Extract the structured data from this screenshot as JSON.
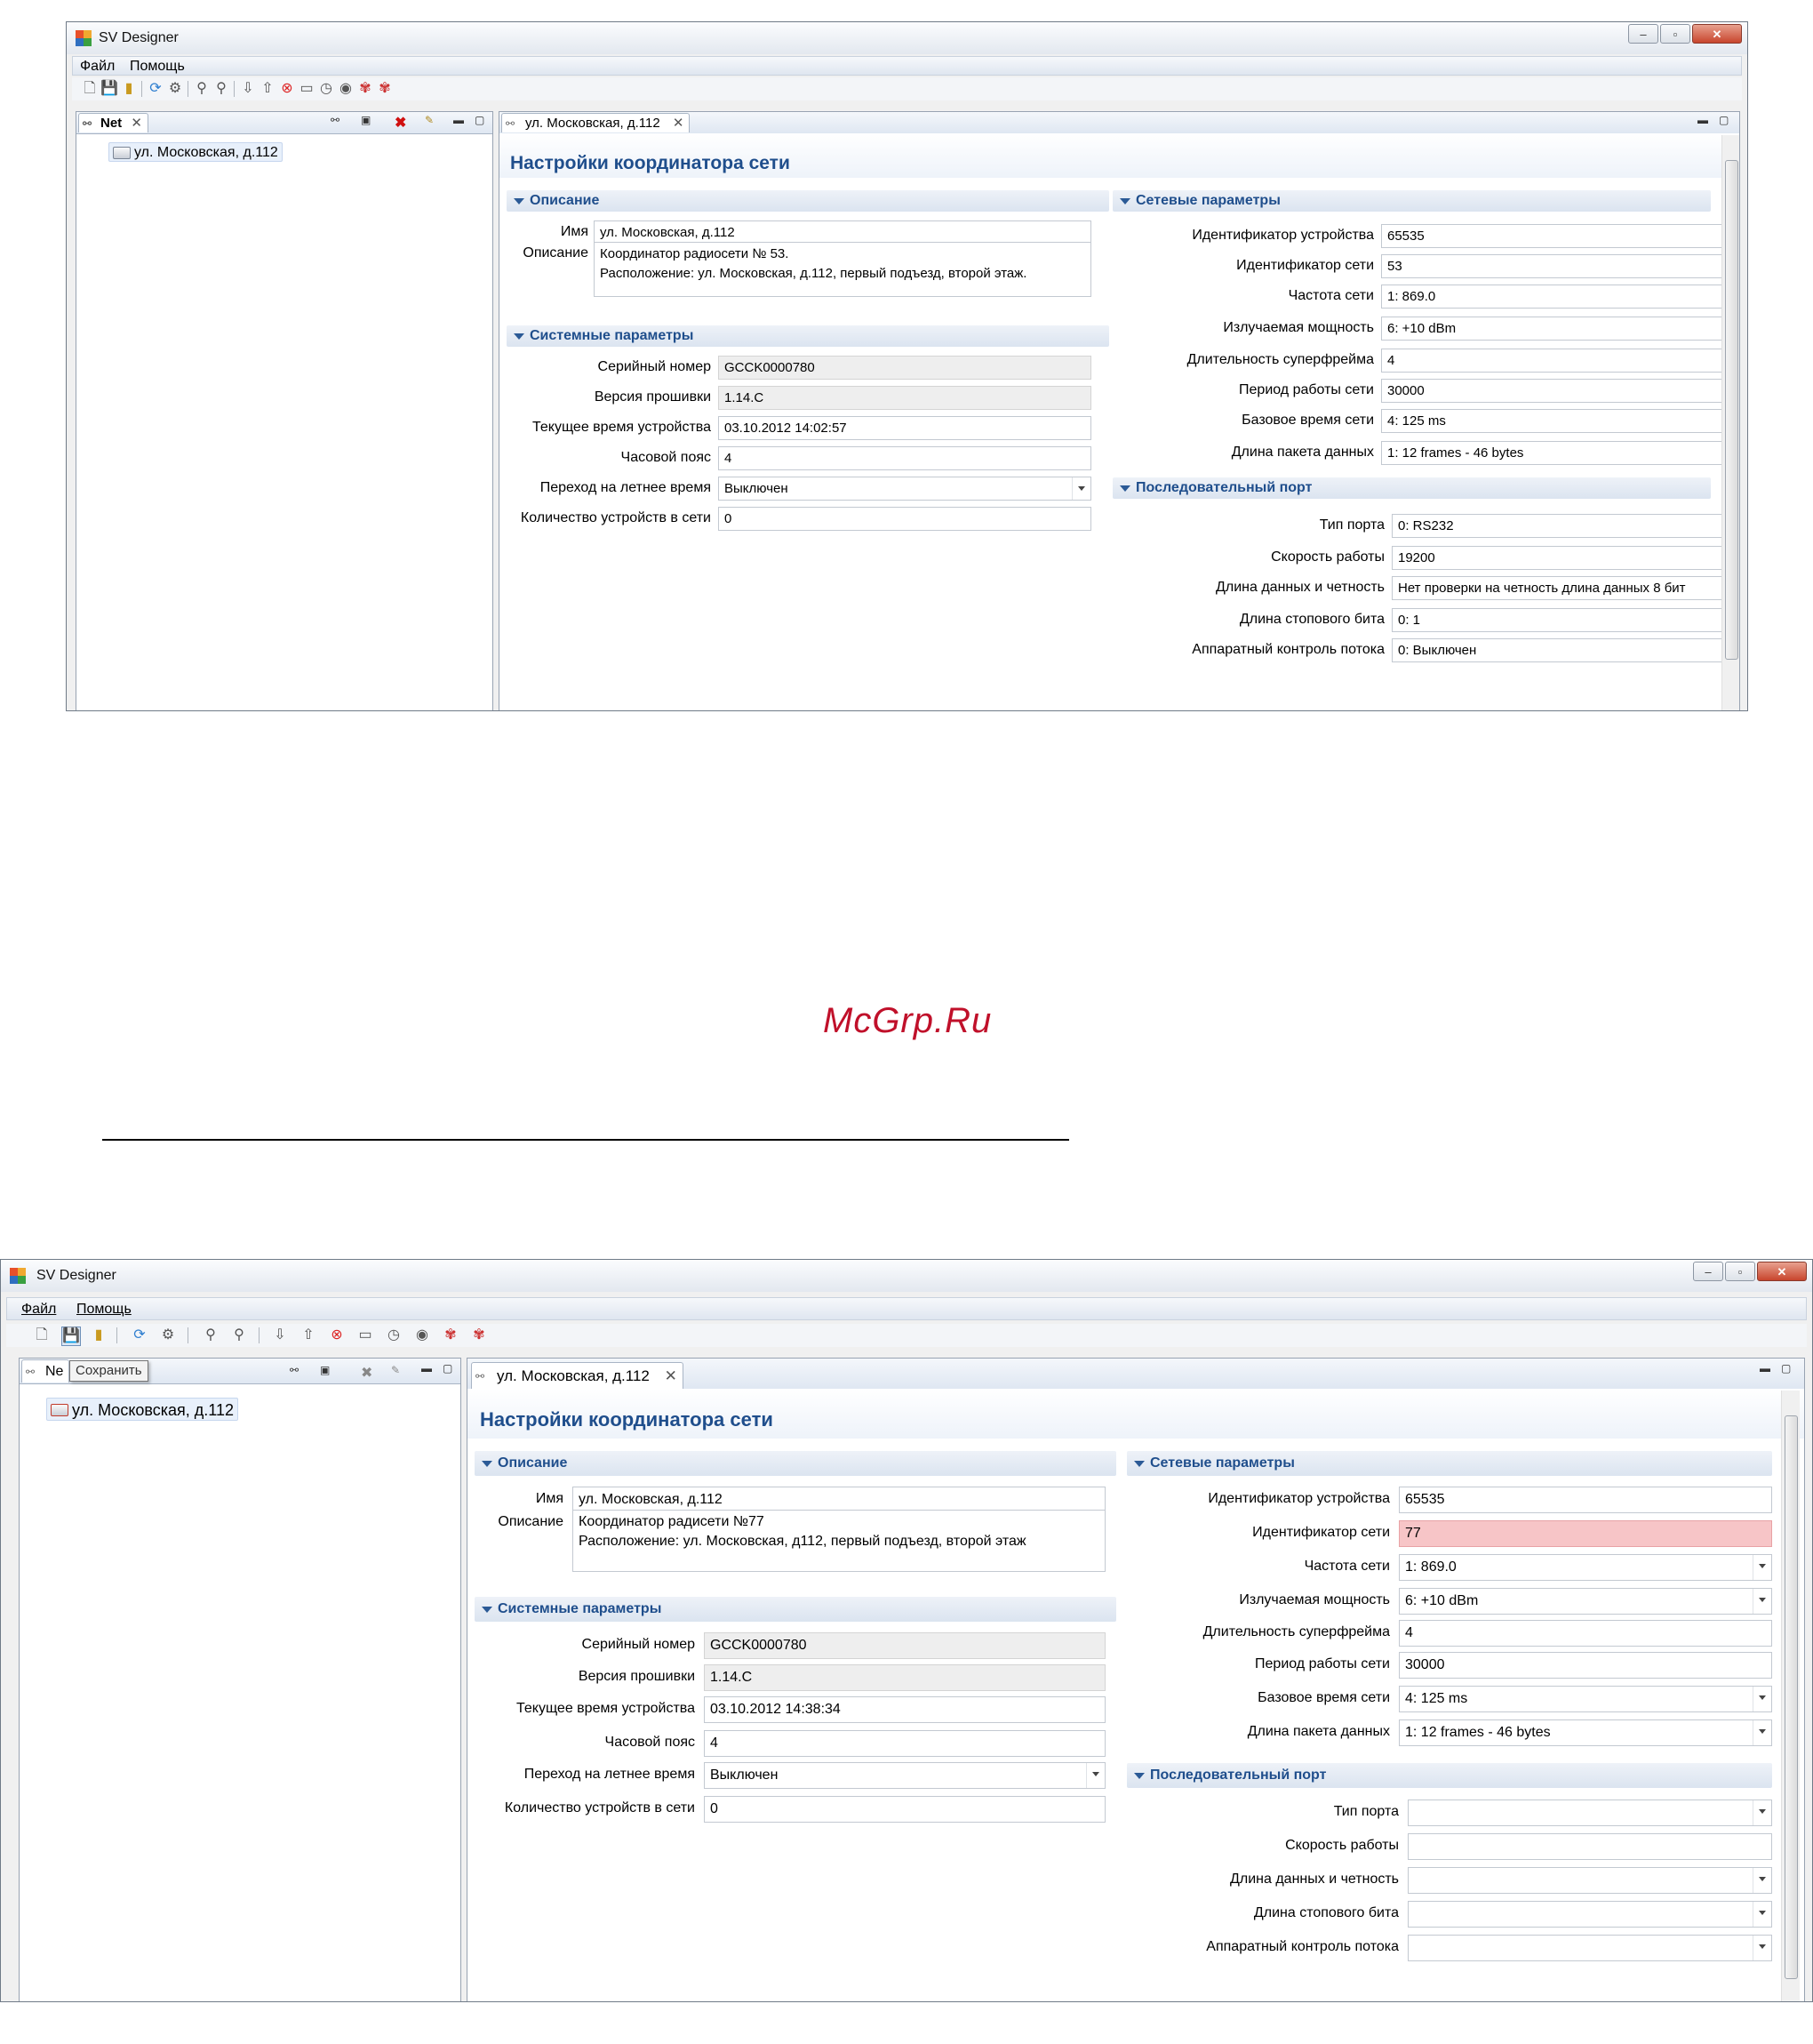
{
  "app_title": "SV Designer",
  "menu": [
    "Файл",
    "Помощь"
  ],
  "window_buttons": {
    "minimize": "–",
    "maximize": "▫",
    "close": "✕"
  },
  "toolbar_icons": [
    "new-file-icon",
    "save-icon",
    "open-icon",
    "refresh-icon",
    "settings-icon",
    "read-icon",
    "write-icon",
    "download-icon",
    "upload-icon",
    "stop-icon",
    "clock-icon",
    "time-icon",
    "eye-icon",
    "radio-icon",
    "radio-alt-icon"
  ],
  "watermark": "McGrp.Ru",
  "colors": {
    "section_text": "#1f4e8c",
    "error_field": "#f7c5c7",
    "close_button": "#c8452d"
  },
  "win1": {
    "tree_view_tab": "Net",
    "tree_item": "ул. Московская, д.112",
    "editor_tab": "ул. Московская, д.112",
    "form_title": "Настройки координатора сети",
    "sec_desc": "Описание",
    "desc_rows": [
      {
        "label": "Имя",
        "value": "ул. Московская, д.112"
      },
      {
        "label": "Описание",
        "value": "Координатор радиосети № 53.\nРасположение: ул. Московская, д.112, первый подъезд, второй этаж."
      }
    ],
    "sec_sys": "Системные параметры",
    "sys_rows": [
      {
        "label": "Серийный номер",
        "value": "GCCK0000780"
      },
      {
        "label": "Версия прошивки",
        "value": "1.14.C"
      },
      {
        "label": "Текущее время устройства",
        "value": "03.10.2012 14:02:57"
      },
      {
        "label": "Часовой пояс",
        "value": "4"
      },
      {
        "label": "Переход на летнее время",
        "value": "Выключен"
      },
      {
        "label": "Количество устройств в сети",
        "value": "0"
      }
    ],
    "sec_net": "Сетевые параметры",
    "net_rows": [
      {
        "label": "Идентификатор устройства",
        "value": "65535"
      },
      {
        "label": "Идентификатор сети",
        "value": "53"
      },
      {
        "label": "Частота сети",
        "value": "1: 869.0"
      },
      {
        "label": "Излучаемая мощность",
        "value": "6: +10 dBm"
      },
      {
        "label": "Длительность суперфрейма",
        "value": "4"
      },
      {
        "label": "Период работы сети",
        "value": "30000"
      },
      {
        "label": "Базовое время сети",
        "value": "4: 125 ms"
      },
      {
        "label": "Длина пакета данных",
        "value": "1: 12 frames - 46 bytes"
      }
    ],
    "sec_ser": "Последовательный порт",
    "ser_rows": [
      {
        "label": "Тип порта",
        "value": "0: RS232"
      },
      {
        "label": "Скорость работы",
        "value": "19200"
      },
      {
        "label": "Длина данных и четность",
        "value": "Нет проверки на четность длина данных 8 бит"
      },
      {
        "label": "Длина стопового бита",
        "value": "0: 1"
      },
      {
        "label": "Аппаратный контроль потока",
        "value": "0: Выключен"
      }
    ]
  },
  "win2": {
    "tree_view_tab": "Ne",
    "tooltip": "Сохранить",
    "tree_item": "ул. Московская, д.112",
    "editor_tab": "ул. Московская, д.112",
    "form_title": "Настройки координатора сети",
    "sec_desc": "Описание",
    "desc_rows": [
      {
        "label": "Имя",
        "value": "ул. Московская, д.112"
      },
      {
        "label": "Описание",
        "value": "Координатор радисети №77\nРасположение: ул. Московская, д112, первый подъезд, второй этаж"
      }
    ],
    "sec_sys": "Системные параметры",
    "sys_rows": [
      {
        "label": "Серийный номер",
        "value": "GCCK0000780"
      },
      {
        "label": "Версия прошивки",
        "value": "1.14.C"
      },
      {
        "label": "Текущее время устройства",
        "value": "03.10.2012 14:38:34"
      },
      {
        "label": "Часовой пояс",
        "value": "4"
      },
      {
        "label": "Переход на летнее время",
        "value": "Выключен"
      },
      {
        "label": "Количество устройств в сети",
        "value": "0"
      }
    ],
    "sec_net": "Сетевые параметры",
    "net_rows": [
      {
        "label": "Идентификатор устройства",
        "value": "65535"
      },
      {
        "label": "Идентификатор сети",
        "value": "77"
      },
      {
        "label": "Частота сети",
        "value": "1: 869.0"
      },
      {
        "label": "Излучаемая мощность",
        "value": "6: +10 dBm"
      },
      {
        "label": "Длительность суперфрейма",
        "value": "4"
      },
      {
        "label": "Период работы сети",
        "value": "30000"
      },
      {
        "label": "Базовое время сети",
        "value": "4: 125 ms"
      },
      {
        "label": "Длина пакета данных",
        "value": "1: 12 frames - 46 bytes"
      }
    ],
    "sec_ser": "Последовательный порт",
    "ser_rows": [
      {
        "label": "Тип порта",
        "value": ""
      },
      {
        "label": "Скорость работы",
        "value": ""
      },
      {
        "label": "Длина данных и четность",
        "value": ""
      },
      {
        "label": "Длина стопового бита",
        "value": ""
      },
      {
        "label": "Аппаратный контроль потока",
        "value": ""
      }
    ]
  }
}
